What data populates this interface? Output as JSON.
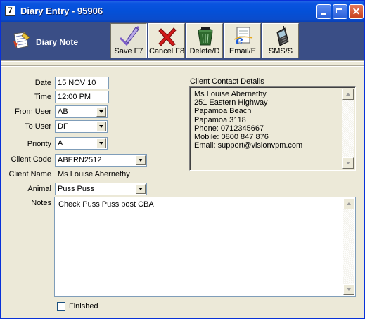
{
  "window": {
    "title": "Diary Entry - 95906",
    "app_icon_glyph": "7",
    "titlebar_color": "#0a54e0",
    "close_glyph": "✕"
  },
  "toolbar": {
    "section_title": "Diary Note",
    "background_color": "#3a4e86",
    "buttons": [
      {
        "label": "Save F7",
        "icon": "checkmark-pen-icon"
      },
      {
        "label": "Cancel F8",
        "icon": "red-x-icon"
      },
      {
        "label": "Delete/D",
        "icon": "trash-bin-icon"
      },
      {
        "label": "Email/E",
        "icon": "email-icon"
      },
      {
        "label": "SMS/S",
        "icon": "mobile-phone-icon"
      }
    ]
  },
  "form": {
    "date": {
      "label": "Date",
      "value": "15 NOV 10"
    },
    "time": {
      "label": "Time",
      "value": "12:00 PM"
    },
    "from_user": {
      "label": "From User",
      "value": "AB"
    },
    "to_user": {
      "label": "To User",
      "value": "DF"
    },
    "priority": {
      "label": "Priority",
      "value": "A"
    },
    "client_code": {
      "label": "Client Code",
      "value": "ABERN2512"
    },
    "client_name": {
      "label": "Client Name",
      "value": "Ms Louise Abernethy"
    },
    "animal": {
      "label": "Animal",
      "value": "Puss Puss"
    },
    "notes": {
      "label": "Notes",
      "value": "Check Puss Puss post CBA"
    },
    "finished": {
      "label": "Finished",
      "checked": false
    }
  },
  "contact": {
    "label": "Client Contact Details",
    "lines": [
      "Ms Louise Abernethy",
      "251 Eastern Highway",
      "Papamoa Beach",
      "Papamoa 3118",
      "Phone: 0712345667",
      "Mobile: 0800 847 876",
      "Email: support@visionvpm.com"
    ]
  }
}
